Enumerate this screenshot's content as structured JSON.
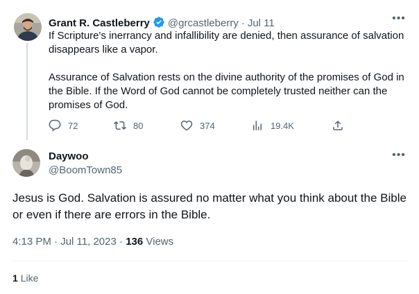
{
  "colors": {
    "text": "#0f1419",
    "muted": "#536471",
    "verified": "#1d9bf0",
    "divider": "#eff3f4"
  },
  "tweet": {
    "author_name": "Grant R. Castleberry",
    "handle": "@grcastleberry",
    "separator": "·",
    "date": "Jul 11",
    "paragraphs": [
      "If Scripture's inerrancy and infallibility are denied, then assurance of salvation disappears like a vapor.",
      "Assurance of Salvation rests on the divine authority of the promises of God in the Bible. If the Word of God cannot be completely trusted neither can the promises of God."
    ],
    "stats": {
      "replies": "72",
      "retweets": "80",
      "likes": "374",
      "views": "19.4K"
    },
    "icons": [
      "verified-badge-icon",
      "more-icon",
      "reply-icon",
      "retweet-icon",
      "like-icon",
      "views-icon",
      "share-icon"
    ]
  },
  "reply": {
    "author_name": "Daywoo",
    "handle": "@BoomTown85",
    "text": "Jesus is God. Salvation is assured no matter what you think about the Bible or even if there are errors in the Bible.",
    "time": "4:13 PM",
    "date": "Jul 11, 2023",
    "separator": "·",
    "views_count": "136",
    "views_label": "Views",
    "likes_count": "1",
    "likes_label": "Like"
  }
}
